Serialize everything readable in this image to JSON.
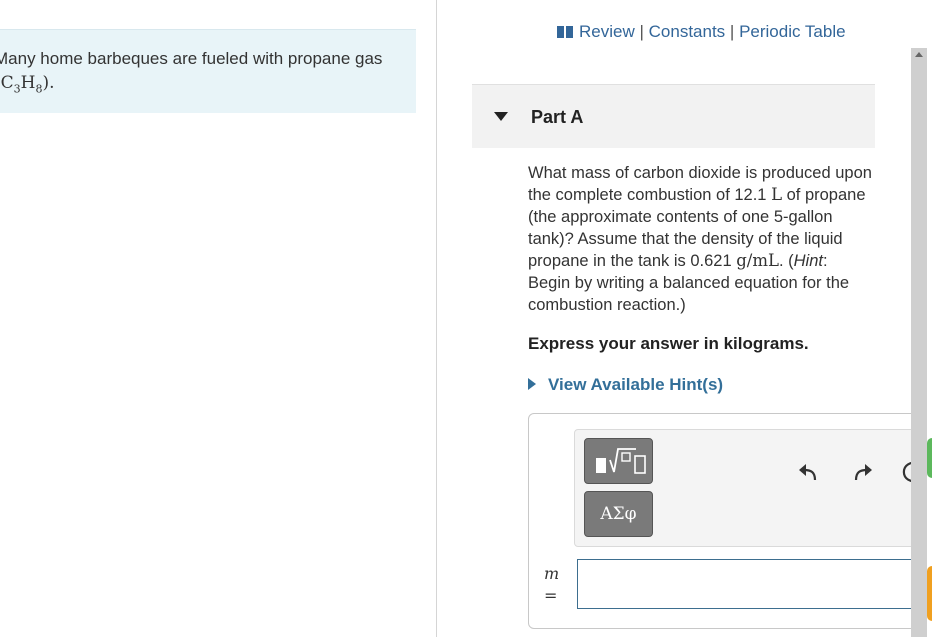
{
  "intro": {
    "line1": "Many home barbeques are fueled with propane gas",
    "formula_open": "(C",
    "sub3": "3",
    "formula_h": "H",
    "sub8": "8",
    "formula_close": ")."
  },
  "links": {
    "review": "Review",
    "constants": "Constants",
    "periodic": "Periodic Table",
    "sep": "|"
  },
  "part": {
    "title": "Part A"
  },
  "question": {
    "t1": "What mass of carbon dioxide is produced upon the complete combustion of 12.1 ",
    "unit_l": "L",
    "t2": " of propane (the approximate contents of one 5-gallon tank)? Assume that the density of the liquid propane in the tank is 0.621 ",
    "unit_gml": "g/mL",
    "t3": ". (",
    "hint_word": "Hint",
    "t4": ": Begin by writing a balanced equation for the combustion reaction.)"
  },
  "express": "Express your answer in kilograms.",
  "hints_link": "View Available Hint(s)",
  "toolbar": {
    "greek_label": "ΑΣφ"
  },
  "answer": {
    "variable": "m",
    "equals": "=",
    "value": ""
  },
  "colors": {
    "link": "#336699",
    "intro_bg": "#e8f4f8",
    "tool_btn": "#7a7a7a",
    "input_border": "#3d6e8f"
  }
}
